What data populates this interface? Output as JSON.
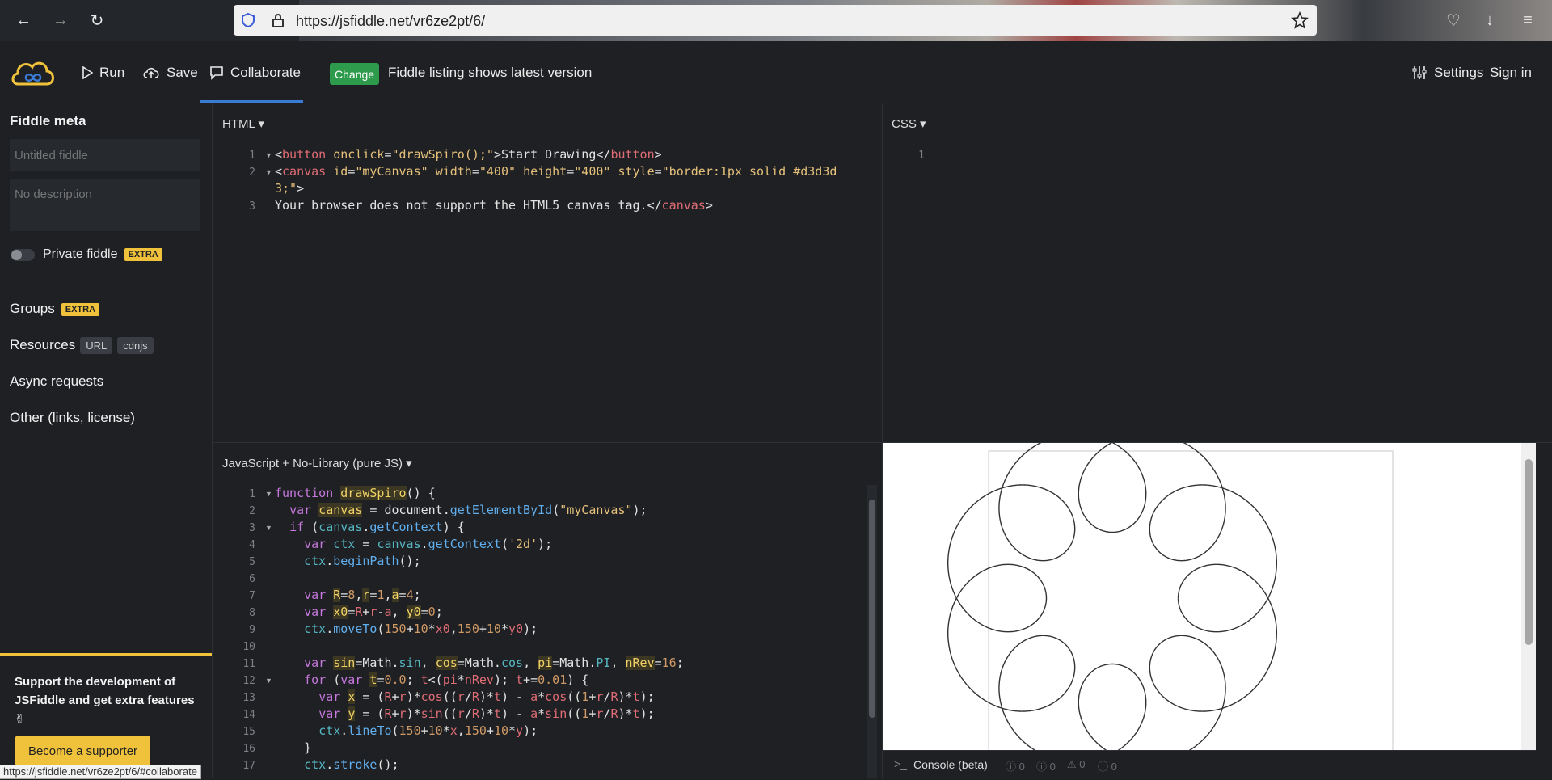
{
  "browser": {
    "url": "https://jsfiddle.net/vr6ze2pt/6/",
    "status_url": "https://jsfiddle.net/vr6ze2pt/6/#collaborate"
  },
  "header": {
    "run": "Run",
    "save": "Save",
    "collaborate": "Collaborate",
    "change_badge": "Change",
    "notice": "Fiddle listing shows latest version",
    "settings": "Settings",
    "sign_in": "Sign in"
  },
  "sidebar": {
    "title": "Fiddle meta",
    "title_placeholder": "Untitled fiddle",
    "description_placeholder": "No description",
    "private_label": "Private fiddle",
    "extra_badge": "EXTRA",
    "groups": "Groups",
    "resources": "Resources",
    "resources_url": "URL",
    "resources_cdnjs": "cdnjs",
    "async": "Async requests",
    "other": "Other (links, license)",
    "support_text": "Support the development of JSFiddle and get extra features ✌",
    "supporter_button": "Become a supporter"
  },
  "html_pane": {
    "label": "HTML",
    "line_numbers": [
      "1",
      "2",
      "",
      "3"
    ]
  },
  "css_pane": {
    "label": "CSS",
    "line_numbers": [
      "1"
    ]
  },
  "js_pane": {
    "label": "JavaScript + No-Library (pure JS)",
    "line_numbers": [
      "1",
      "2",
      "3",
      "4",
      "5",
      "6",
      "7",
      "8",
      "9",
      "10",
      "11",
      "12",
      "13",
      "14",
      "15",
      "16",
      "17"
    ]
  },
  "console": {
    "label": "Console (beta)",
    "counts": [
      "0",
      "0",
      "0",
      "0"
    ]
  },
  "colors": {
    "accent_blue": "#3a7bd5",
    "change_green": "#2e9a4c",
    "extra_yellow": "#f0c23b"
  },
  "icons": [
    "back-icon",
    "forward-icon",
    "reload-icon",
    "shield-icon",
    "lock-icon",
    "star-icon",
    "play-icon",
    "cloud-upload-icon",
    "chat-icon",
    "sliders-icon",
    "jsfiddle-logo-icon"
  ]
}
